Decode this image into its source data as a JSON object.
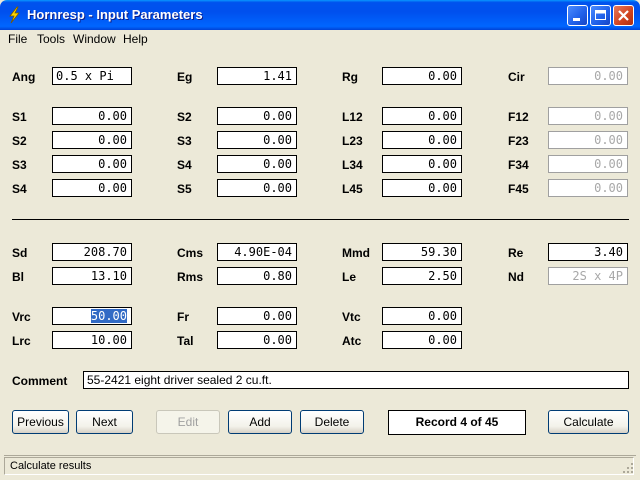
{
  "window": {
    "title": "Hornresp - Input Parameters"
  },
  "menu": [
    "File",
    "Tools",
    "Window",
    "Help"
  ],
  "rows": {
    "r1": [
      {
        "label": "Ang",
        "value": "0.5 x Pi",
        "align": "left",
        "state": "normal"
      },
      {
        "label": "Eg",
        "value": "1.41",
        "state": "normal"
      },
      {
        "label": "Rg",
        "value": "0.00",
        "state": "normal"
      },
      {
        "label": "Cir",
        "value": "0.00",
        "state": "disabled"
      }
    ],
    "r2": [
      {
        "label": "S1",
        "value": "0.00",
        "state": "normal"
      },
      {
        "label": "S2",
        "value": "0.00",
        "state": "normal"
      },
      {
        "label": "L12",
        "value": "0.00",
        "state": "normal"
      },
      {
        "label": "F12",
        "value": "0.00",
        "state": "disabled"
      }
    ],
    "r3": [
      {
        "label": "S2",
        "value": "0.00",
        "state": "normal"
      },
      {
        "label": "S3",
        "value": "0.00",
        "state": "normal"
      },
      {
        "label": "L23",
        "value": "0.00",
        "state": "normal"
      },
      {
        "label": "F23",
        "value": "0.00",
        "state": "disabled"
      }
    ],
    "r4": [
      {
        "label": "S3",
        "value": "0.00",
        "state": "normal"
      },
      {
        "label": "S4",
        "value": "0.00",
        "state": "normal"
      },
      {
        "label": "L34",
        "value": "0.00",
        "state": "normal"
      },
      {
        "label": "F34",
        "value": "0.00",
        "state": "disabled"
      }
    ],
    "r5": [
      {
        "label": "S4",
        "value": "0.00",
        "state": "normal"
      },
      {
        "label": "S5",
        "value": "0.00",
        "state": "normal"
      },
      {
        "label": "L45",
        "value": "0.00",
        "state": "normal"
      },
      {
        "label": "F45",
        "value": "0.00",
        "state": "disabled"
      }
    ],
    "r6": [
      {
        "label": "Sd",
        "value": "208.70",
        "state": "normal"
      },
      {
        "label": "Cms",
        "value": "4.90E-04",
        "state": "normal"
      },
      {
        "label": "Mmd",
        "value": "59.30",
        "state": "normal"
      },
      {
        "label": "Re",
        "value": "3.40",
        "state": "normal"
      }
    ],
    "r7": [
      {
        "label": "Bl",
        "value": "13.10",
        "state": "normal"
      },
      {
        "label": "Rms",
        "value": "0.80",
        "state": "normal"
      },
      {
        "label": "Le",
        "value": "2.50",
        "state": "normal"
      },
      {
        "label": "Nd",
        "value": "2S x 4P",
        "state": "disabled"
      }
    ],
    "r8": [
      {
        "label": "Vrc",
        "value": "50.00",
        "state": "selected"
      },
      {
        "label": "Fr",
        "value": "0.00",
        "state": "normal"
      },
      {
        "label": "Vtc",
        "value": "0.00",
        "state": "normal"
      }
    ],
    "r9": [
      {
        "label": "Lrc",
        "value": "10.00",
        "state": "normal"
      },
      {
        "label": "Tal",
        "value": "0.00",
        "state": "normal"
      },
      {
        "label": "Atc",
        "value": "0.00",
        "state": "normal"
      }
    ]
  },
  "comment": {
    "label": "Comment",
    "value": "55-2421 eight driver sealed 2 cu.ft."
  },
  "buttons": {
    "previous": "Previous",
    "next": "Next",
    "edit": "Edit",
    "add": "Add",
    "delete": "Delete",
    "calculate": "Calculate"
  },
  "record": "Record 4 of 45",
  "status": "Calculate results"
}
